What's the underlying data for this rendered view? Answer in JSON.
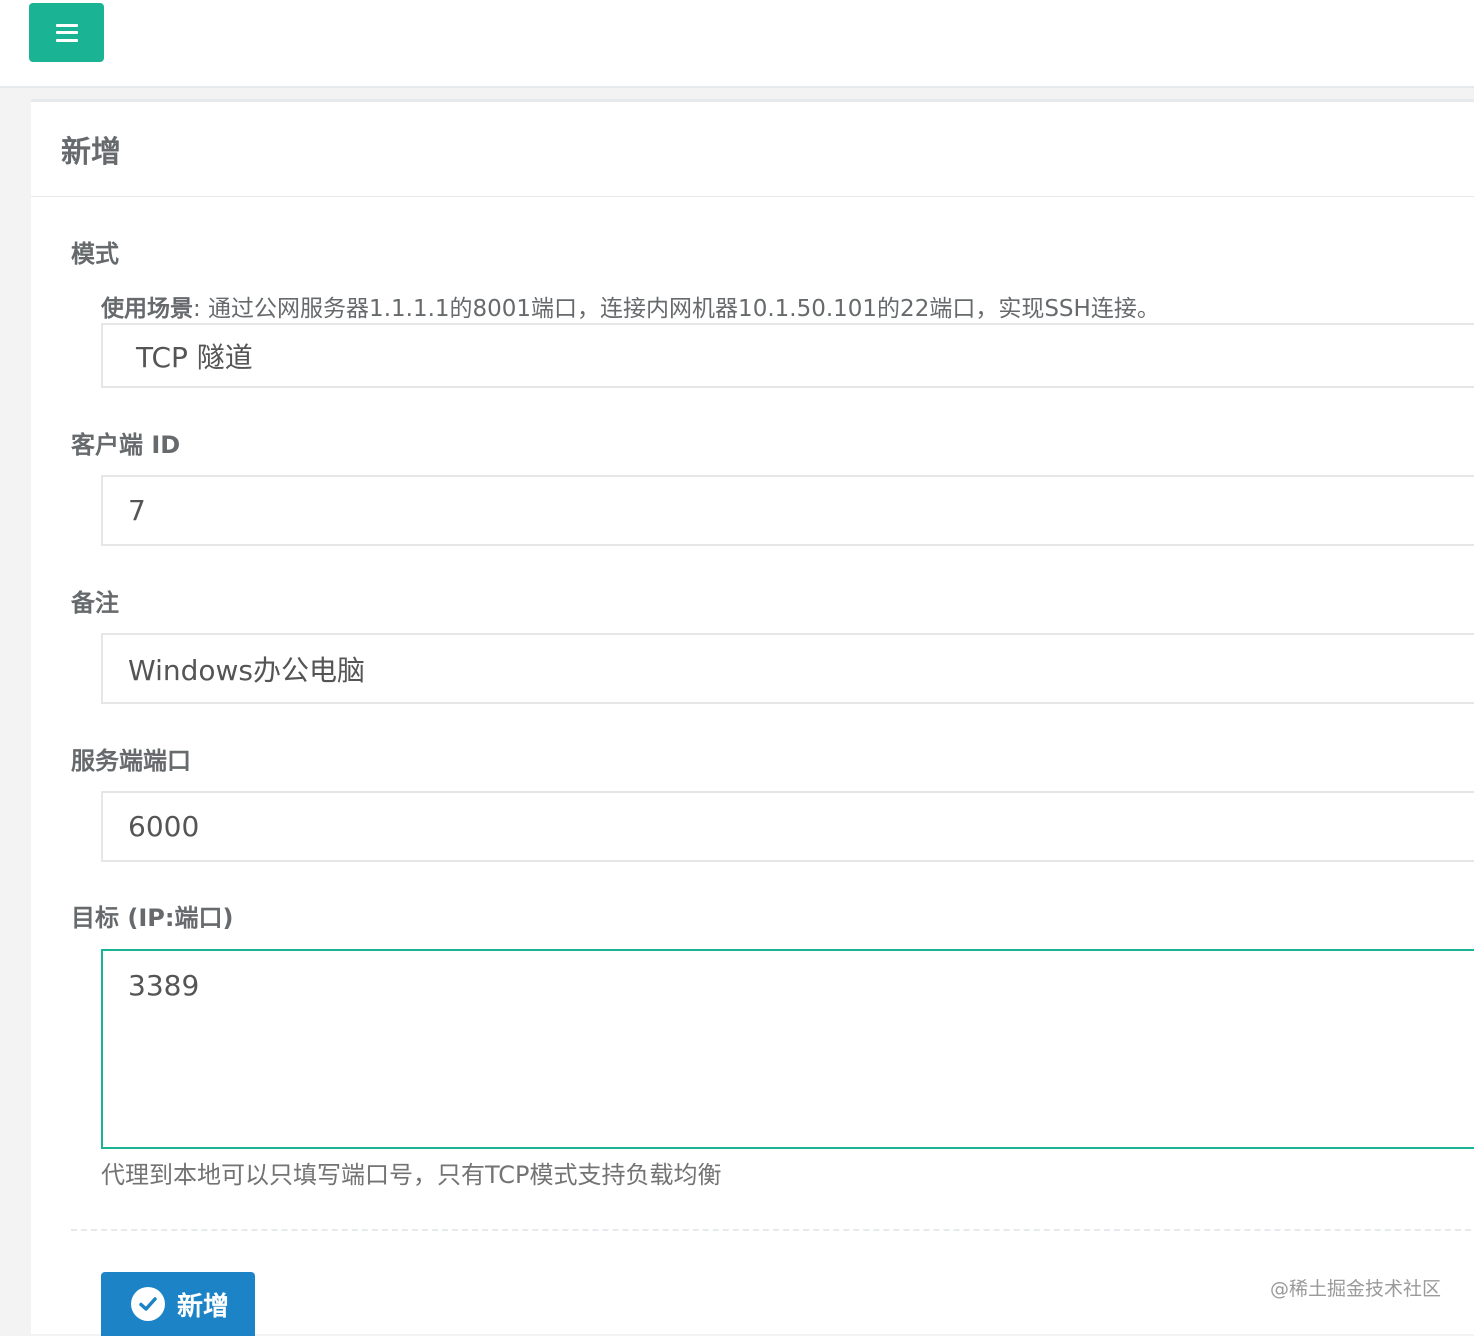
{
  "header": {
    "menu_icon": "hamburger-icon"
  },
  "panel": {
    "title": "新增"
  },
  "form": {
    "mode": {
      "label": "模式",
      "hint_prefix": "使用场景",
      "hint_text": ": 通过公网服务器1.1.1.1的8001端口，连接内网机器10.1.50.101的22端口，实现SSH连接。",
      "value": "TCP 隧道"
    },
    "client_id": {
      "label": "客户端 ID",
      "value": "7"
    },
    "remark": {
      "label": "备注",
      "value": "Windows办公电脑"
    },
    "server_port": {
      "label": "服务端端口",
      "value": "6000"
    },
    "target": {
      "label": "目标 (IP:端口)",
      "value": "3389",
      "help": "代理到本地可以只填写端口号，只有TCP模式支持负载均衡"
    },
    "submit_label": "新增",
    "submit_icon": "check-circle-icon"
  },
  "watermark": "@稀土掘金技术社区",
  "colors": {
    "primary": "#1ab394",
    "button_blue": "#1c84c6",
    "text": "#676a6c"
  }
}
